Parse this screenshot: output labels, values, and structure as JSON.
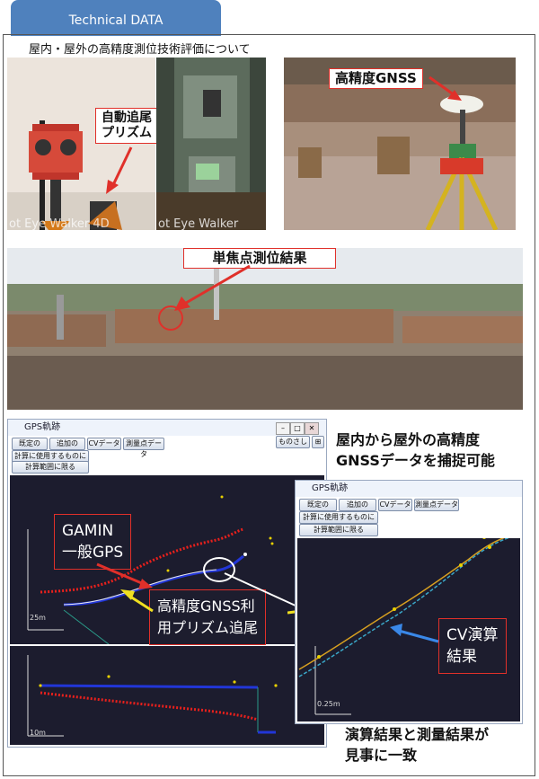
{
  "header": {
    "tab_label": "Technical DATA"
  },
  "section": {
    "heading": "屋内・屋外の高精度測位技術評価について"
  },
  "photos": {
    "prism_label": "自動追尾\nプリズム",
    "ghost_caption_left": "ot Eye Walker  4D",
    "ghost_caption_right": "ot Eye Walker",
    "gnss_label": "高精度GNSS",
    "panorama_label": "単焦点測位結果"
  },
  "gps_window_left": {
    "title": "GPS軌跡",
    "buttons": [
      "既定のGPS",
      "追加のGPS",
      "CVデータ",
      "測量点データ"
    ],
    "filter_button": "計算に使用するものに限る",
    "range_button": "計算範囲に限る",
    "close_button": "ものさし",
    "scale_top": "25m",
    "scale_bottom": "10m"
  },
  "gps_window_right": {
    "title": "GPS軌跡",
    "buttons": [
      "既定のGPS",
      "追加のGPS",
      "CVデータ",
      "測量点データ"
    ],
    "filter_button": "計算に使用するものに限る",
    "range_button": "計算範囲に限る",
    "scale": "0.25m"
  },
  "annotations": {
    "gamin": "GAMIN\n一般GPS",
    "gnss_prism": "高精度GNSS利\n用プリズム追尾",
    "cv_result": "CV演算\n結果"
  },
  "texts": {
    "capture_line1": "屋内から屋外の高精度",
    "capture_line2": "GNSSデータを捕捉可能",
    "match_line1": "演算結果と測量結果が",
    "match_line2": "見事に一致"
  },
  "colors": {
    "accent_blue": "#4f81bd",
    "callout_red": "#e0302a",
    "plot_bg": "#1c1c2e",
    "gps_red": "#e8201c",
    "gnss_blue": "#2236d8",
    "cv_cyan": "#3aa7c8",
    "survey_orange": "#d8a020"
  }
}
